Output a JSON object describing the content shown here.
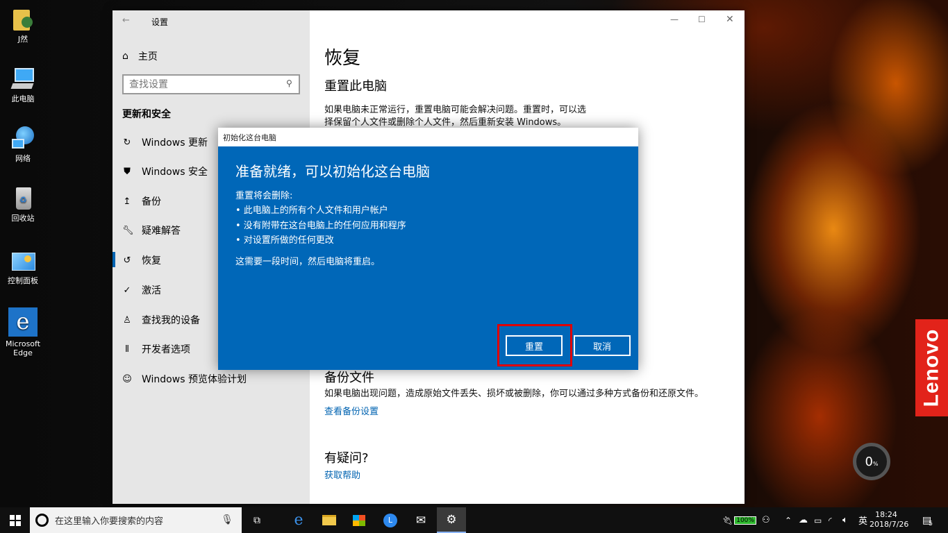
{
  "desktop": {
    "icons": [
      {
        "label": "J然"
      },
      {
        "label": "此电脑"
      },
      {
        "label": "网络"
      },
      {
        "label": "回收站"
      },
      {
        "label": "控制面板"
      },
      {
        "label": "Microsoft Edge"
      }
    ],
    "brand": "Lenovo",
    "gauge_value": "0",
    "gauge_unit": "%"
  },
  "settings": {
    "title": "设置",
    "home_label": "主页",
    "search_placeholder": "查找设置",
    "section_title": "更新和安全",
    "nav": [
      {
        "label": "Windows 更新",
        "icon": "refresh-icon"
      },
      {
        "label": "Windows 安全",
        "icon": "shield-icon"
      },
      {
        "label": "备份",
        "icon": "upload-arrow-icon"
      },
      {
        "label": "疑难解答",
        "icon": "wrench-icon"
      },
      {
        "label": "恢复",
        "icon": "history-icon",
        "selected": true
      },
      {
        "label": "激活",
        "icon": "check-circle-icon"
      },
      {
        "label": "查找我的设备",
        "icon": "person-location-icon"
      },
      {
        "label": "开发者选项",
        "icon": "developer-sliders-icon"
      },
      {
        "label": "Windows 预览体验计划",
        "icon": "insider-cat-icon"
      }
    ],
    "main": {
      "heading": "恢复",
      "reset_title": "重置此电脑",
      "reset_desc_line1": "如果电脑未正常运行，重置电脑可能会解决问题。重置时，可以选",
      "reset_desc_line2": "择保留个人文件或删除个人文件，然后重新安装 Windows。",
      "backup_title": "备份文件",
      "backup_desc": "如果电脑出现问题，造成原始文件丢失、损坏或被删除，你可以通过多种方式备份和还原文件。",
      "backup_link": "查看备份设置",
      "question_title": "有疑问?",
      "help_link": "获取帮助"
    }
  },
  "dialog": {
    "window_title": "初始化这台电脑",
    "heading": "准备就绪，可以初始化这台电脑",
    "intro": "重置将会删除:",
    "items": [
      "• 此电脑上的所有个人文件和用户帐户",
      "• 没有附带在这台电脑上的任何应用和程序",
      "• 对设置所做的任何更改"
    ],
    "note": "这需要一段时间，然后电脑将重启。",
    "reset_button": "重置",
    "cancel_button": "取消"
  },
  "taskbar": {
    "search_placeholder": "在这里输入你要搜索的内容",
    "battery": "100%",
    "ime": "英",
    "time": "18:24",
    "date": "2018/7/26",
    "notifications": "5"
  },
  "colors": {
    "accent": "#0067b8",
    "highlight": "#e10000",
    "lenovo_red": "#e2231a"
  }
}
